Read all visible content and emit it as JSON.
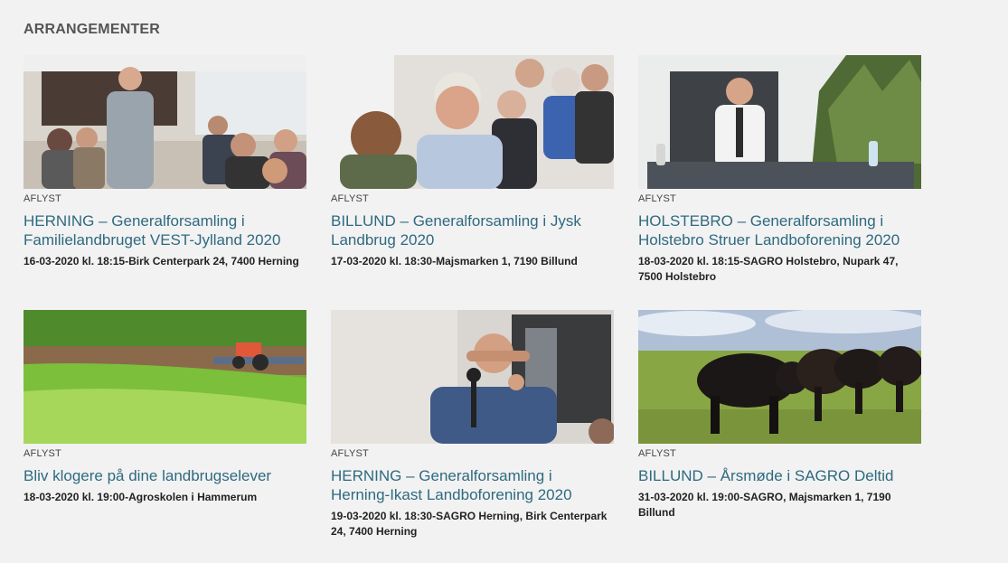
{
  "section": {
    "title": "ARRANGEMENTER"
  },
  "events": [
    {
      "status": "AFLYST",
      "title": "HERNING – Generalforsamling i Familielandbruget VEST-Jylland 2020",
      "meta": "16-03-2020 kl. 18:15-Birk Centerpark 24, 7400 Herning",
      "image": "photo-standing-man-audience"
    },
    {
      "status": "AFLYST",
      "title": "BILLUND – Generalforsamling i Jysk Landbrug 2020",
      "meta": "17-03-2020 kl. 18:30-Majsmarken 1, 7190 Billund",
      "image": "photo-seated-audience"
    },
    {
      "status": "AFLYST",
      "title": "HOLSTEBRO – Generalforsamling i Holstebro Struer Landboforening 2020",
      "meta": "18-03-2020 kl. 18:15-SAGRO Holstebro, Nupark 47, 7500 Holstebro",
      "image": "photo-speaker-podium"
    },
    {
      "status": "AFLYST",
      "title": "Bliv klogere på dine landbrugselever",
      "meta": "18-03-2020 kl. 19:00-Agroskolen i Hammerum",
      "image": "photo-tractor-field"
    },
    {
      "status": "AFLYST",
      "title": "HERNING – Generalforsamling i Herning-Ikast Landboforening 2020",
      "meta": "19-03-2020 kl. 18:30-SAGRO Herning, Birk Centerpark 24, 7400 Herning",
      "image": "photo-man-microphone"
    },
    {
      "status": "AFLYST",
      "title": "BILLUND – Årsmøde i SAGRO Deltid",
      "meta": "31-03-2020 kl. 19:00-SAGRO, Majsmarken 1, 7190 Billund",
      "image": "photo-black-cattle"
    }
  ]
}
